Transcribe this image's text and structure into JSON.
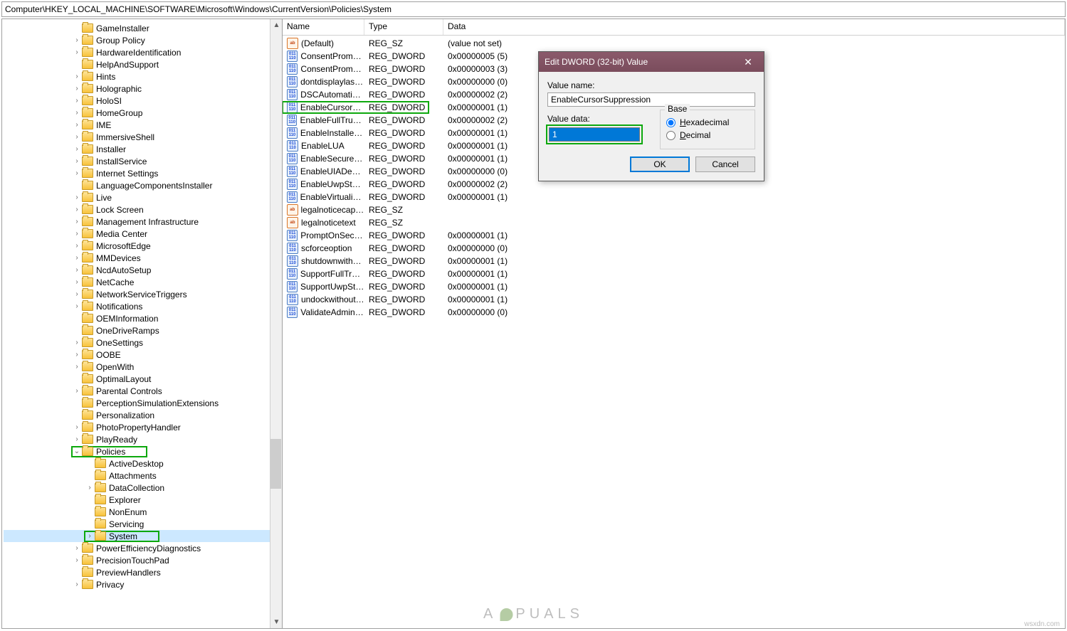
{
  "address_bar": "Computer\\HKEY_LOCAL_MACHINE\\SOFTWARE\\Microsoft\\Windows\\CurrentVersion\\Policies\\System",
  "tree": {
    "base_indent": 96,
    "items": [
      {
        "label": "GameInstaller",
        "exp": "none",
        "indent": 0
      },
      {
        "label": "Group Policy",
        "exp": "closed",
        "indent": 0
      },
      {
        "label": "HardwareIdentification",
        "exp": "closed",
        "indent": 0
      },
      {
        "label": "HelpAndSupport",
        "exp": "none",
        "indent": 0
      },
      {
        "label": "Hints",
        "exp": "closed",
        "indent": 0
      },
      {
        "label": "Holographic",
        "exp": "closed",
        "indent": 0
      },
      {
        "label": "HoloSI",
        "exp": "closed",
        "indent": 0
      },
      {
        "label": "HomeGroup",
        "exp": "closed",
        "indent": 0
      },
      {
        "label": "IME",
        "exp": "closed",
        "indent": 0
      },
      {
        "label": "ImmersiveShell",
        "exp": "closed",
        "indent": 0
      },
      {
        "label": "Installer",
        "exp": "closed",
        "indent": 0
      },
      {
        "label": "InstallService",
        "exp": "closed",
        "indent": 0
      },
      {
        "label": "Internet Settings",
        "exp": "closed",
        "indent": 0
      },
      {
        "label": "LanguageComponentsInstaller",
        "exp": "none",
        "indent": 0
      },
      {
        "label": "Live",
        "exp": "closed",
        "indent": 0
      },
      {
        "label": "Lock Screen",
        "exp": "closed",
        "indent": 0
      },
      {
        "label": "Management Infrastructure",
        "exp": "closed",
        "indent": 0
      },
      {
        "label": "Media Center",
        "exp": "closed",
        "indent": 0
      },
      {
        "label": "MicrosoftEdge",
        "exp": "closed",
        "indent": 0
      },
      {
        "label": "MMDevices",
        "exp": "closed",
        "indent": 0
      },
      {
        "label": "NcdAutoSetup",
        "exp": "closed",
        "indent": 0
      },
      {
        "label": "NetCache",
        "exp": "closed",
        "indent": 0
      },
      {
        "label": "NetworkServiceTriggers",
        "exp": "closed",
        "indent": 0
      },
      {
        "label": "Notifications",
        "exp": "closed",
        "indent": 0
      },
      {
        "label": "OEMInformation",
        "exp": "none",
        "indent": 0
      },
      {
        "label": "OneDriveRamps",
        "exp": "none",
        "indent": 0
      },
      {
        "label": "OneSettings",
        "exp": "closed",
        "indent": 0
      },
      {
        "label": "OOBE",
        "exp": "closed",
        "indent": 0
      },
      {
        "label": "OpenWith",
        "exp": "closed",
        "indent": 0
      },
      {
        "label": "OptimalLayout",
        "exp": "none",
        "indent": 0
      },
      {
        "label": "Parental Controls",
        "exp": "closed",
        "indent": 0
      },
      {
        "label": "PerceptionSimulationExtensions",
        "exp": "none",
        "indent": 0
      },
      {
        "label": "Personalization",
        "exp": "none",
        "indent": 0
      },
      {
        "label": "PhotoPropertyHandler",
        "exp": "closed",
        "indent": 0
      },
      {
        "label": "PlayReady",
        "exp": "closed",
        "indent": 0
      },
      {
        "label": "Policies",
        "exp": "open",
        "indent": 0,
        "green": true
      },
      {
        "label": "ActiveDesktop",
        "exp": "none",
        "indent": 1
      },
      {
        "label": "Attachments",
        "exp": "none",
        "indent": 1
      },
      {
        "label": "DataCollection",
        "exp": "closed",
        "indent": 1
      },
      {
        "label": "Explorer",
        "exp": "none",
        "indent": 1
      },
      {
        "label": "NonEnum",
        "exp": "none",
        "indent": 1
      },
      {
        "label": "Servicing",
        "exp": "none",
        "indent": 1
      },
      {
        "label": "System",
        "exp": "closed",
        "indent": 1,
        "green": true,
        "selected": true
      },
      {
        "label": "PowerEfficiencyDiagnostics",
        "exp": "closed",
        "indent": 0
      },
      {
        "label": "PrecisionTouchPad",
        "exp": "closed",
        "indent": 0
      },
      {
        "label": "PreviewHandlers",
        "exp": "none",
        "indent": 0
      },
      {
        "label": "Privacy",
        "exp": "closed",
        "indent": 0
      }
    ]
  },
  "columns": {
    "name": "Name",
    "type": "Type",
    "data": "Data"
  },
  "values": [
    {
      "name": "(Default)",
      "type": "REG_SZ",
      "data": "(value not set)",
      "icon": "sz"
    },
    {
      "name": "ConsentPrompt...",
      "type": "REG_DWORD",
      "data": "0x00000005 (5)",
      "icon": "dw"
    },
    {
      "name": "ConsentPrompt...",
      "type": "REG_DWORD",
      "data": "0x00000003 (3)",
      "icon": "dw"
    },
    {
      "name": "dontdisplaylastu...",
      "type": "REG_DWORD",
      "data": "0x00000000 (0)",
      "icon": "dw"
    },
    {
      "name": "DSCAutomation...",
      "type": "REG_DWORD",
      "data": "0x00000002 (2)",
      "icon": "dw"
    },
    {
      "name": "EnableCursorSu...",
      "type": "REG_DWORD",
      "data": "0x00000001 (1)",
      "icon": "dw",
      "green": true
    },
    {
      "name": "EnableFullTrustS...",
      "type": "REG_DWORD",
      "data": "0x00000002 (2)",
      "icon": "dw"
    },
    {
      "name": "EnableInstallerD...",
      "type": "REG_DWORD",
      "data": "0x00000001 (1)",
      "icon": "dw"
    },
    {
      "name": "EnableLUA",
      "type": "REG_DWORD",
      "data": "0x00000001 (1)",
      "icon": "dw"
    },
    {
      "name": "EnableSecureUI...",
      "type": "REG_DWORD",
      "data": "0x00000001 (1)",
      "icon": "dw"
    },
    {
      "name": "EnableUIADeskt...",
      "type": "REG_DWORD",
      "data": "0x00000000 (0)",
      "icon": "dw"
    },
    {
      "name": "EnableUwpStart...",
      "type": "REG_DWORD",
      "data": "0x00000002 (2)",
      "icon": "dw"
    },
    {
      "name": "EnableVirtualizat...",
      "type": "REG_DWORD",
      "data": "0x00000001 (1)",
      "icon": "dw"
    },
    {
      "name": "legalnoticecapti...",
      "type": "REG_SZ",
      "data": "",
      "icon": "sz"
    },
    {
      "name": "legalnoticetext",
      "type": "REG_SZ",
      "data": "",
      "icon": "sz"
    },
    {
      "name": "PromptOnSecur...",
      "type": "REG_DWORD",
      "data": "0x00000001 (1)",
      "icon": "dw"
    },
    {
      "name": "scforceoption",
      "type": "REG_DWORD",
      "data": "0x00000000 (0)",
      "icon": "dw"
    },
    {
      "name": "shutdownwitho...",
      "type": "REG_DWORD",
      "data": "0x00000001 (1)",
      "icon": "dw"
    },
    {
      "name": "SupportFullTrust...",
      "type": "REG_DWORD",
      "data": "0x00000001 (1)",
      "icon": "dw"
    },
    {
      "name": "SupportUwpStar...",
      "type": "REG_DWORD",
      "data": "0x00000001 (1)",
      "icon": "dw"
    },
    {
      "name": "undockwithoutl...",
      "type": "REG_DWORD",
      "data": "0x00000001 (1)",
      "icon": "dw"
    },
    {
      "name": "ValidateAdminC...",
      "type": "REG_DWORD",
      "data": "0x00000000 (0)",
      "icon": "dw"
    }
  ],
  "dialog": {
    "title": "Edit DWORD (32-bit) Value",
    "value_name_label": "Value name:",
    "value_name": "EnableCursorSuppression",
    "value_data_label": "Value data:",
    "value_data": "1",
    "base_label": "Base",
    "hexadecimal": "Hexadecimal",
    "decimal": "Decimal",
    "ok": "OK",
    "cancel": "Cancel"
  },
  "watermark": "A  PUALS",
  "credit": "wsxdn.com"
}
